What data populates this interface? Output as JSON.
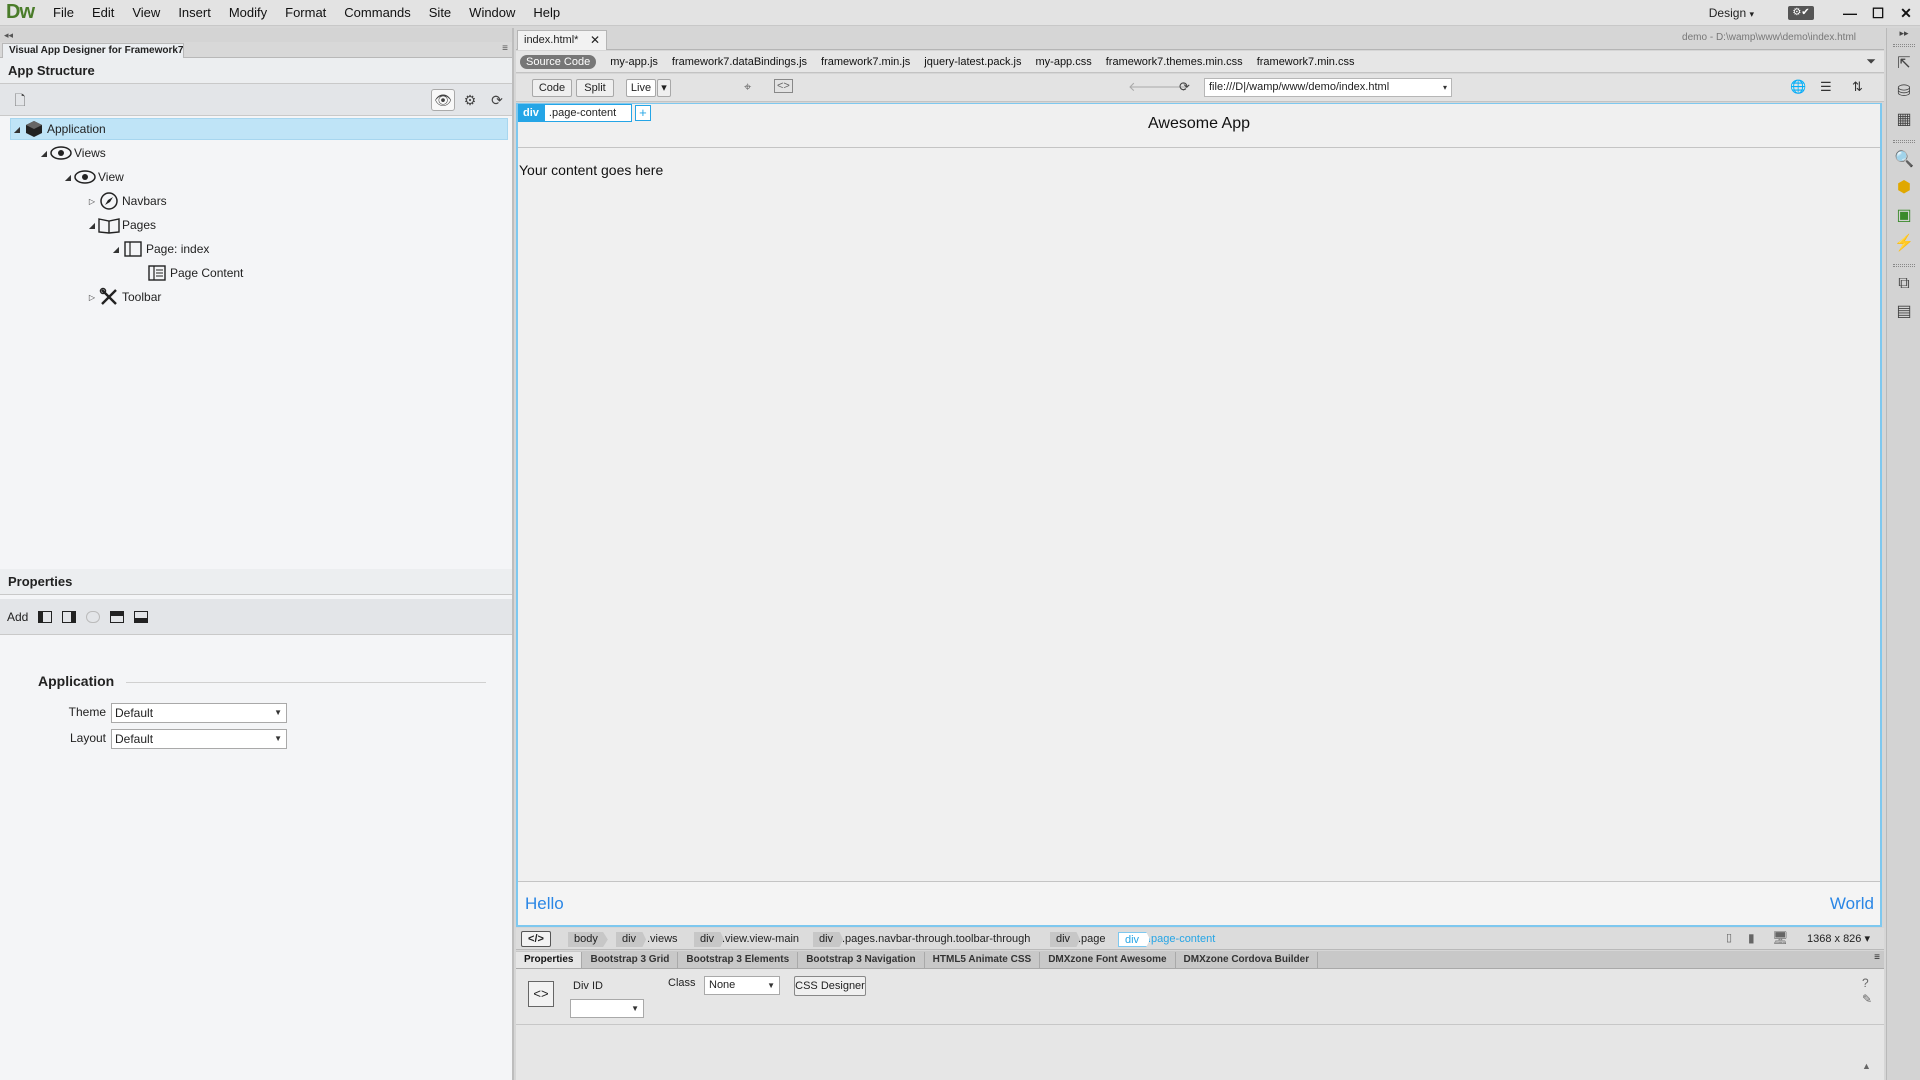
{
  "app": {
    "logo": "Dw",
    "menu": [
      "File",
      "Edit",
      "View",
      "Insert",
      "Modify",
      "Format",
      "Commands",
      "Site",
      "Window",
      "Help"
    ],
    "workspace": "Design",
    "workspace_arrow": "▾",
    "window_controls": {
      "minimize": "—",
      "maximize": "☐",
      "close": "✕"
    }
  },
  "left_panel": {
    "collapse_glyph": "◂◂",
    "tab_title": "Visual App Designer for Framework7",
    "tab_menu_glyph": "≡",
    "structure_title": "App Structure",
    "tree": [
      {
        "label": "Application",
        "icon": "cube-icon",
        "arrow": "◢",
        "selected": true
      },
      {
        "label": "Views",
        "icon": "eye-icon",
        "arrow": "◢"
      },
      {
        "label": "View",
        "icon": "eye-icon",
        "arrow": "◢"
      },
      {
        "label": "Navbars",
        "icon": "compass-icon",
        "arrow": "▷"
      },
      {
        "label": "Pages",
        "icon": "book-icon",
        "arrow": "◢"
      },
      {
        "label": "Page: index",
        "icon": "page-icon",
        "arrow": "◢"
      },
      {
        "label": "Page Content",
        "icon": "page-content-icon",
        "arrow": ""
      },
      {
        "label": "Toolbar",
        "icon": "tools-icon",
        "arrow": "▷"
      }
    ],
    "properties_title": "Properties",
    "add_label": "Add",
    "app_props_heading": "Application",
    "theme_label": "Theme",
    "theme_value": "Default",
    "layout_label": "Layout",
    "layout_value": "Default"
  },
  "document": {
    "tab_label": "index.html*",
    "tab_close": "✕",
    "path": "demo - D:\\wamp\\www\\demo\\index.html",
    "related_files": [
      "Source Code",
      "my-app.js",
      "framework7.dataBindings.js",
      "framework7.min.js",
      "jquery-latest.pack.js",
      "my-app.css",
      "framework7.themes.min.css",
      "framework7.min.css"
    ],
    "view_buttons": {
      "code": "Code",
      "split": "Split",
      "live": "Live",
      "live_menu": "▾"
    },
    "url": "file:///D|/wamp/www/demo/index.html",
    "url_arrow": "▾"
  },
  "live_view": {
    "hud_tag": "div",
    "hud_class": ".page-content",
    "hud_plus": "+",
    "navbar_title": "Awesome App",
    "content": "Your content goes here",
    "toolbar_left": "Hello",
    "toolbar_right": "World"
  },
  "tag_selector": {
    "code_toggle": "</>",
    "crumbs": [
      "body",
      "div",
      ".views",
      "div",
      ".view.view-main",
      "div",
      ".pages.navbar-through.toolbar-through",
      "div",
      ".page",
      "div",
      ".page-content"
    ],
    "window_size": "1368 x 826 ▾"
  },
  "bottom_panel": {
    "tabs": [
      "Properties",
      "Bootstrap 3 Grid",
      "Bootstrap 3 Elements",
      "Bootstrap 3 Navigation",
      "HTML5 Animate CSS",
      "DMXzone Font Awesome",
      "DMXzone Cordova Builder"
    ],
    "tab_menu_glyph": "≡",
    "tag_icon_glyph": "<>",
    "div_id_label": "Div ID",
    "class_label": "Class",
    "class_value": "None",
    "css_designer": "CSS Designer"
  },
  "colors": {
    "selection": "#bfe4f7",
    "live_border": "#7ec8ef",
    "hud_blue": "#25a5e6",
    "link_blue": "#2a86e5",
    "logo_green": "#4a7c2a"
  }
}
